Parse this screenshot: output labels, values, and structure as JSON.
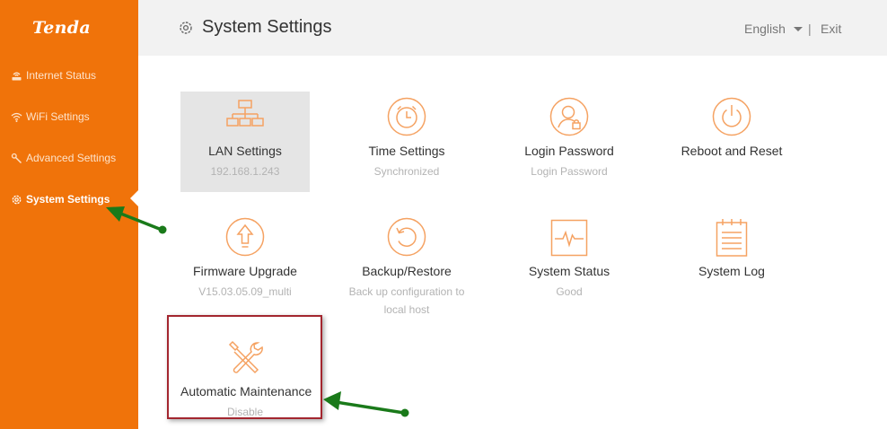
{
  "sidebar": {
    "logo": "Tenda",
    "items": [
      {
        "label": "Internet Status",
        "icon": "router-icon"
      },
      {
        "label": "WiFi Settings",
        "icon": "wifi-icon"
      },
      {
        "label": "Advanced Settings",
        "icon": "wrench-icon"
      },
      {
        "label": "System Settings",
        "icon": "gear-icon",
        "active": true
      }
    ]
  },
  "header": {
    "title": "System Settings",
    "language": "English",
    "separator": "|",
    "exit": "Exit"
  },
  "tiles": [
    {
      "label": "LAN Settings",
      "sub": "192.168.1.243",
      "icon": "network-topology-icon",
      "selected": true
    },
    {
      "label": "Time Settings",
      "sub": "Synchronized",
      "icon": "alarm-clock-icon"
    },
    {
      "label": "Login Password",
      "sub": "Login Password",
      "icon": "user-lock-icon"
    },
    {
      "label": "Reboot and Reset",
      "sub": "",
      "icon": "power-icon"
    },
    {
      "label": "Firmware Upgrade",
      "sub": "V15.03.05.09_multi",
      "icon": "upgrade-arrow-icon"
    },
    {
      "label": "Backup/Restore",
      "sub": "Back up configuration to local host",
      "icon": "restore-icon"
    },
    {
      "label": "System Status",
      "sub": "Good",
      "icon": "pulse-monitor-icon"
    },
    {
      "label": "System Log",
      "sub": "",
      "icon": "log-notepad-icon"
    },
    {
      "label": "Automatic Maintenance",
      "sub": "Disable",
      "icon": "tools-icon"
    }
  ],
  "colors": {
    "brand_orange": "#f0730a",
    "icon_orange": "#f5a262",
    "annotation_green": "#1a7a1a",
    "highlight_red": "#a3262f"
  }
}
